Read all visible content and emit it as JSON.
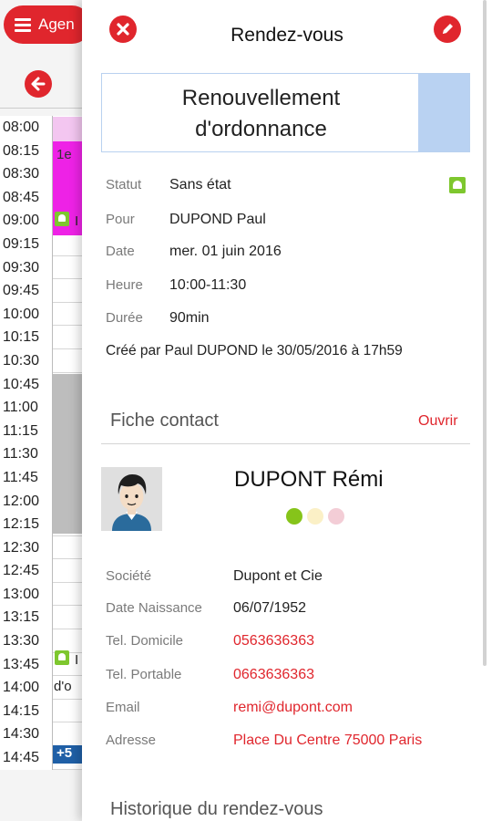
{
  "agenda": {
    "menu_label": "Agen",
    "times": [
      "08:00",
      "08:15",
      "08:30",
      "08:45",
      "09:00",
      "09:15",
      "09:30",
      "09:45",
      "10:00",
      "10:15",
      "10:30",
      "10:45",
      "11:00",
      "11:15",
      "11:30",
      "11:45",
      "12:00",
      "12:15",
      "12:30",
      "12:45",
      "13:00",
      "13:15",
      "13:30",
      "13:45",
      "14:00",
      "14:15",
      "14:30",
      "14:45"
    ],
    "event_text_1": "I",
    "event_text_2": "1e",
    "event_text_3": "I",
    "event_text_4": "d'o",
    "more_badge": "+5"
  },
  "header": {
    "title": "Rendez-vous"
  },
  "appointment": {
    "title_line1": "Renouvellement",
    "title_line2": "d'ordonnance",
    "color": "#b9d2f2"
  },
  "details": {
    "statut_label": "Statut",
    "statut_value": "Sans état",
    "pour_label": "Pour",
    "pour_value": "DUPOND Paul",
    "date_label": "Date",
    "date_value": "mer. 01 juin 2016",
    "heure_label": "Heure",
    "heure_value": "10:00-11:30",
    "duree_label": "Durée",
    "duree_value": "90min",
    "created": "Créé par Paul DUPOND le 30/05/2016 à 17h59"
  },
  "contact": {
    "section_title": "Fiche contact",
    "open_link": "Ouvrir",
    "name": "DUPONT Rémi",
    "dot_colors": [
      "#86c41a",
      "#fbf0c6",
      "#f3cdd6"
    ],
    "societe_label": "Société",
    "societe_value": "Dupont et Cie",
    "naissance_label": "Date Naissance",
    "naissance_value": "06/07/1952",
    "tel_dom_label": "Tel. Domicile",
    "tel_dom_value": "0563636363",
    "tel_port_label": "Tel. Portable",
    "tel_port_value": "0663636363",
    "email_label": "Email",
    "email_value": "remi@dupont.com",
    "adresse_label": "Adresse",
    "adresse_value": "Place Du Centre 75000 Paris"
  },
  "history": {
    "section_title": "Historique du rendez-vous"
  }
}
